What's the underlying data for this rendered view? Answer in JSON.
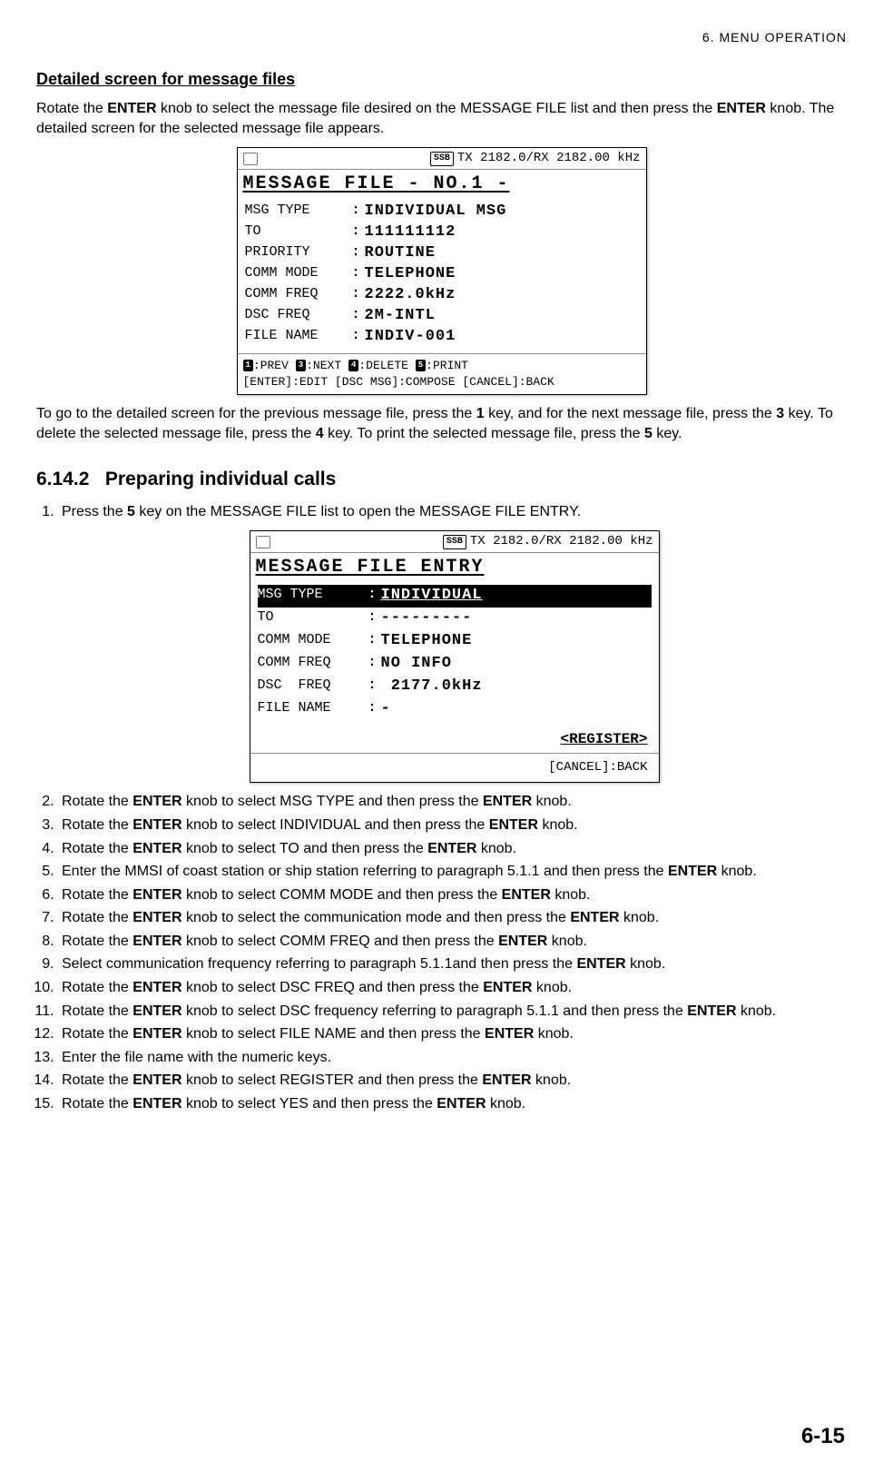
{
  "header": {
    "chapter": "6.  MENU  OPERATION"
  },
  "section1": {
    "title": "Detailed screen for message files",
    "para1a": "Rotate the ",
    "para1b": "ENTER",
    "para1c": " knob to select the message file desired on the MESSAGE FILE list and then press the ",
    "para1d": "ENTER",
    "para1e": " knob. The detailed screen for the selected message file appears.",
    "para2a": "To go to the detailed screen for the previous message file, press the ",
    "para2b": "1",
    "para2c": " key, and for the next message file, press the ",
    "para2d": "3",
    "para2e": " key. To delete the selected message file, press the ",
    "para2f": "4",
    "para2g": " key. To print the selected message file, press the ",
    "para2h": "5",
    "para2i": " key."
  },
  "lcd1": {
    "ssb": "SSB",
    "freq": "TX 2182.0/RX 2182.00 kHz",
    "title": "MESSAGE FILE  - NO.1 -",
    "rows": [
      {
        "label": "MSG TYPE",
        "val": "INDIVIDUAL MSG"
      },
      {
        "label": "TO",
        "val": "111111112"
      },
      {
        "label": "PRIORITY",
        "val": "ROUTINE"
      },
      {
        "label": "COMM MODE",
        "val": "TELEPHONE"
      },
      {
        "label": "COMM FREQ",
        "val": "2222.0kHz"
      },
      {
        "label": "DSC FREQ",
        "val": "2M-INTL"
      },
      {
        "label": "FILE NAME",
        "val": "INDIV-001"
      }
    ],
    "footer1_parts": [
      "1",
      ":PREV ",
      "3",
      ":NEXT ",
      "4",
      ":DELETE ",
      "5",
      ":PRINT"
    ],
    "footer2": "[ENTER]:EDIT   [DSC MSG]:COMPOSE [CANCEL]:BACK"
  },
  "subsection": {
    "number": "6.14.2",
    "title": "Preparing individual calls"
  },
  "steps": [
    [
      {
        "t": "Press the "
      },
      {
        "b": "5"
      },
      {
        "t": " key on the MESSAGE FILE list to open the MESSAGE FILE ENTRY."
      }
    ],
    [
      {
        "t": "Rotate the "
      },
      {
        "b": "ENTER"
      },
      {
        "t": " knob to select MSG TYPE and then press the "
      },
      {
        "b": "ENTER"
      },
      {
        "t": " knob."
      }
    ],
    [
      {
        "t": "Rotate the "
      },
      {
        "b": "ENTER"
      },
      {
        "t": " knob to select INDIVIDUAL and then press the "
      },
      {
        "b": "ENTER"
      },
      {
        "t": " knob."
      }
    ],
    [
      {
        "t": "Rotate the "
      },
      {
        "b": "ENTER"
      },
      {
        "t": " knob to select TO and then press the "
      },
      {
        "b": "ENTER"
      },
      {
        "t": " knob."
      }
    ],
    [
      {
        "t": "Enter the MMSI of coast station or ship station referring to paragraph 5.1.1 and then press the "
      },
      {
        "b": "ENTER"
      },
      {
        "t": " knob."
      }
    ],
    [
      {
        "t": "Rotate the "
      },
      {
        "b": "ENTER"
      },
      {
        "t": " knob to select COMM MODE and then press the "
      },
      {
        "b": "ENTER"
      },
      {
        "t": " knob."
      }
    ],
    [
      {
        "t": "Rotate the "
      },
      {
        "b": "ENTER"
      },
      {
        "t": " knob to select the communication mode and then press the "
      },
      {
        "b": "ENTER"
      },
      {
        "t": " knob."
      }
    ],
    [
      {
        "t": "Rotate the "
      },
      {
        "b": "ENTER"
      },
      {
        "t": " knob to select COMM FREQ and then press the "
      },
      {
        "b": "ENTER"
      },
      {
        "t": " knob."
      }
    ],
    [
      {
        "t": "Select communication frequency referring to paragraph 5.1.1and then press the "
      },
      {
        "b": "ENTER"
      },
      {
        "t": " knob."
      }
    ],
    [
      {
        "t": "Rotate the "
      },
      {
        "b": "ENTER"
      },
      {
        "t": " knob to select DSC FREQ and then press the "
      },
      {
        "b": "ENTER"
      },
      {
        "t": " knob."
      }
    ],
    [
      {
        "t": "Rotate the "
      },
      {
        "b": "ENTER"
      },
      {
        "t": " knob to select DSC frequency referring to paragraph 5.1.1 and then press the "
      },
      {
        "b": "ENTER"
      },
      {
        "t": " knob."
      }
    ],
    [
      {
        "t": "Rotate the "
      },
      {
        "b": "ENTER"
      },
      {
        "t": " knob to select FILE NAME and then press the "
      },
      {
        "b": "ENTER"
      },
      {
        "t": " knob."
      }
    ],
    [
      {
        "t": "Enter the file name with the numeric keys."
      }
    ],
    [
      {
        "t": "Rotate the "
      },
      {
        "b": "ENTER"
      },
      {
        "t": " knob to select REGISTER and then press the "
      },
      {
        "b": "ENTER"
      },
      {
        "t": " knob."
      }
    ],
    [
      {
        "t": "Rotate the "
      },
      {
        "b": "ENTER"
      },
      {
        "t": " knob to select YES and then press the "
      },
      {
        "b": "ENTER"
      },
      {
        "t": " knob."
      }
    ]
  ],
  "lcd2": {
    "ssb": "SSB",
    "freq": "TX 2182.0/RX 2182.00 kHz",
    "title": "MESSAGE FILE  ENTRY",
    "rows": [
      {
        "label": "MSG TYPE ",
        "val": "INDIVIDUAL",
        "hl": true
      },
      {
        "label": "TO       ",
        "val": "---------"
      },
      {
        "label": "COMM MODE",
        "val": "TELEPHONE"
      },
      {
        "label": "COMM FREQ",
        "val": "NO INFO"
      },
      {
        "label": "DSC  FREQ",
        "val": " 2177.0kHz"
      },
      {
        "label": "FILE NAME",
        "val": "-"
      }
    ],
    "register": "<REGISTER>",
    "cancel": "[CANCEL]:BACK"
  },
  "pageNumber": "6-15"
}
